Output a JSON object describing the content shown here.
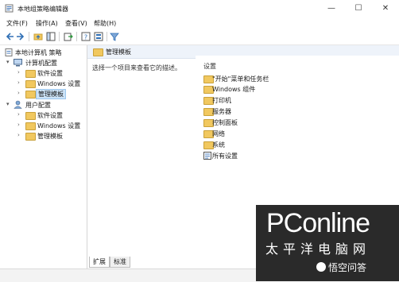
{
  "window": {
    "title": "本地组策略编辑器",
    "minimize": "—",
    "maximize": "☐",
    "close": "✕"
  },
  "menu": [
    "文件(F)",
    "操作(A)",
    "查看(V)",
    "帮助(H)"
  ],
  "toolbar": {
    "icons": [
      "back-arrow-icon",
      "forward-arrow-icon",
      "up-folder-icon",
      "show-hide-tree-icon",
      "export-list-icon",
      "help-icon",
      "properties-icon",
      "filter-icon"
    ]
  },
  "tree": {
    "root": "本地计算机 策略",
    "computer_config": "计算机配置",
    "computer_children": [
      "软件设置",
      "Windows 设置",
      "管理模板"
    ],
    "user_config": "用户配置",
    "user_children": [
      "软件设置",
      "Windows 设置",
      "管理模板"
    ]
  },
  "right": {
    "header": "管理模板",
    "description": "选择一个项目来查看它的描述。",
    "column_header": "设置",
    "items": [
      "\"开始\"菜单和任务栏",
      "Windows 组件",
      "打印机",
      "服务器",
      "控制面板",
      "网络",
      "系统",
      "所有设置"
    ]
  },
  "tabs": [
    "扩展",
    "标准"
  ],
  "watermark": {
    "logo": "PConline",
    "cn": "太平洋电脑网",
    "qa": "悟空问答"
  },
  "colors": {
    "folder": "#f1c85f",
    "selection": "#cce3f7",
    "watermark_bg": "#2a2a2a"
  }
}
